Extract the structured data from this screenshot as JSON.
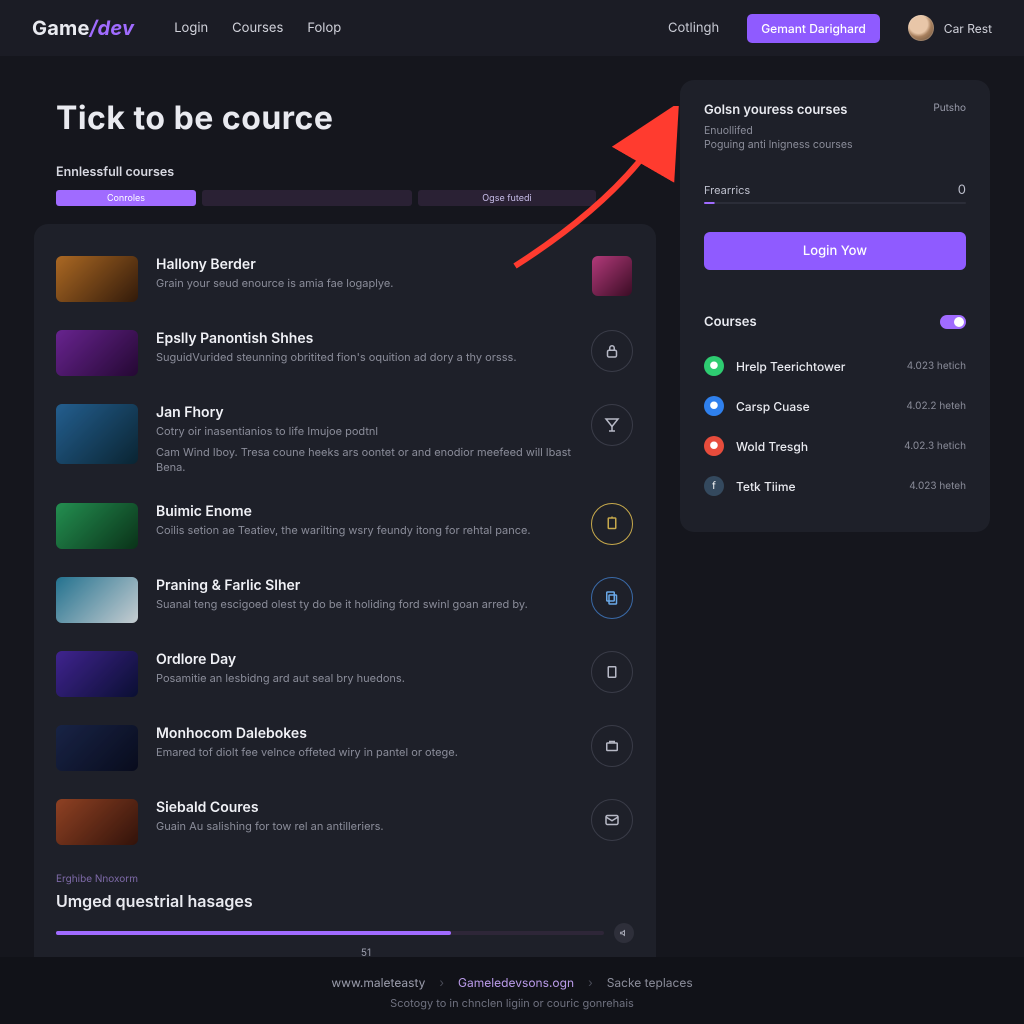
{
  "nav": {
    "logo_a": "Game",
    "logo_b": "/dev",
    "links": [
      "Login",
      "Courses",
      "Folop"
    ],
    "right_link": "Cotlingh",
    "cta": "Gemant Darighard",
    "user": "Car Rest"
  },
  "page_title": "Tick to be cource",
  "seg_label": "Ennlessfull courses",
  "segs": [
    "Conroles",
    "",
    "Ogse futedi"
  ],
  "courses": [
    {
      "title": "Hallony Berder",
      "desc": "Grain your seud enource is amia fae logaplye."
    },
    {
      "title": "Epslly Panontish Shhes",
      "desc": "SuguidVurided steunning obritited fion's oquition ad dory a thy orsss."
    },
    {
      "title": "Jan Fhory",
      "desc": "Cotry oir inasentianios to life Imujoe podtnl",
      "desc2": "Cam Wind Iboy. Tresa coune heeks ars oontet or and enodior meefeed will lbast Bena."
    },
    {
      "title": "Buimic Enome",
      "desc": "Coilis setion ae Teatiev, the warilting wsry feundy itong for rehtal pance."
    },
    {
      "title": "Praning & Farlic Slher",
      "desc": "Suanal teng escigoed olest ty do be it holiding ford swinl goan arred by."
    },
    {
      "title": "Ordlore Day",
      "desc": "Posamitie an lesbidng ard aut seal bry huedons."
    },
    {
      "title": "Monhocom Dalebokes",
      "desc": "Emared tof diolt fee velnce offeted wiry in pantel or otege."
    },
    {
      "title": "Siebald Coures",
      "desc": "Guain Au salishing for tow rel an antilleriers."
    }
  ],
  "card_footer": {
    "eyebrow": "Erghibe Nnoxorm",
    "title": "Umged questrial hasages",
    "value": "51"
  },
  "sidebar": {
    "title": "Golsn youress courses",
    "sub1": "Enuollifed",
    "sub2": "Poguing anti lnigness courses",
    "badge": "Putsho",
    "stat_label": "Frearrics",
    "stat_value": "0",
    "cta": "Login Yow",
    "list_label": "Courses",
    "items": [
      {
        "name": "Hrelp Teerichtower",
        "meta": "4.023 hetich"
      },
      {
        "name": "Carsp Cuase",
        "meta": "4.02.2 heteh"
      },
      {
        "name": "Wold Tresgh",
        "meta": "4.02.3 hetich"
      },
      {
        "name": "Tetk Tiime",
        "meta": "4.023 heteh"
      }
    ]
  },
  "footer": {
    "crumbs": [
      "www.maleteasty",
      "Gameledevsons.ogn",
      "Sacke teplaces"
    ],
    "tagline": "Scotogy to in chnclen ligiin or couric gonrehais"
  }
}
